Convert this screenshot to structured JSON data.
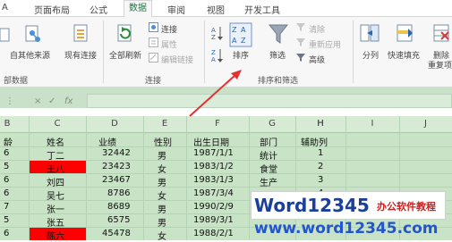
{
  "tabs": [
    "A",
    "页面布局",
    "公式",
    "数据",
    "审阅",
    "视图",
    "开发工具"
  ],
  "active_tab": "数据",
  "ribbon": {
    "from_other_sources": "自其他来源",
    "existing_connections": "现有连接",
    "refresh_all": "全部刷新",
    "connections": "连接",
    "properties": "属性",
    "edit_links": "编辑链接",
    "sort": "排序",
    "filter": "筛选",
    "clear": "清除",
    "reapply": "重新应用",
    "advanced": "高级",
    "text_to_columns": "分列",
    "flash_fill": "快速填充",
    "remove_duplicates_1": "删除",
    "remove_duplicates_2": "重复项",
    "group_get_data": "部数据",
    "group_connections": "连接",
    "group_sort_filter": "排序和筛选"
  },
  "formula_bar": {
    "cancel": "×",
    "enter": "✓",
    "fx": "fx"
  },
  "columns": [
    "B",
    "C",
    "D",
    "E",
    "F",
    "G",
    "H",
    "I",
    "J"
  ],
  "header_row": [
    "龄",
    "姓名",
    "业绩",
    "性别",
    "出生日期",
    "部门",
    "辅助列"
  ],
  "rows": [
    [
      "6",
      "丁二",
      "32442",
      "男",
      "1987/1/1",
      "统计",
      "1"
    ],
    [
      "5",
      "王八",
      "23423",
      "女",
      "1983/1/2",
      "食堂",
      "2"
    ],
    [
      "6",
      "刘四",
      "23467",
      "男",
      "1983/1/3",
      "生产",
      "3"
    ],
    [
      "6",
      "吴七",
      "8786",
      "女",
      "1987/3/4",
      "设计",
      "4"
    ],
    [
      "7",
      "张一",
      "8689",
      "男",
      "1990/2/9",
      "",
      ""
    ],
    [
      "5",
      "张五",
      "6575",
      "男",
      "1989/3/1",
      "",
      ""
    ],
    [
      "6",
      "陈六",
      "45478",
      "女",
      "1988/2/1",
      "",
      ""
    ]
  ],
  "highlighted_rows": [
    1,
    6
  ],
  "colors": {
    "accent": "#217346",
    "highlight_red": "#ff0000",
    "grid_bg": "#c8e3c5",
    "arrow": "#e53030"
  },
  "watermark": {
    "brand": "Word12345",
    "tagline": "办公软件教程",
    "url": "www.word12345.com"
  }
}
